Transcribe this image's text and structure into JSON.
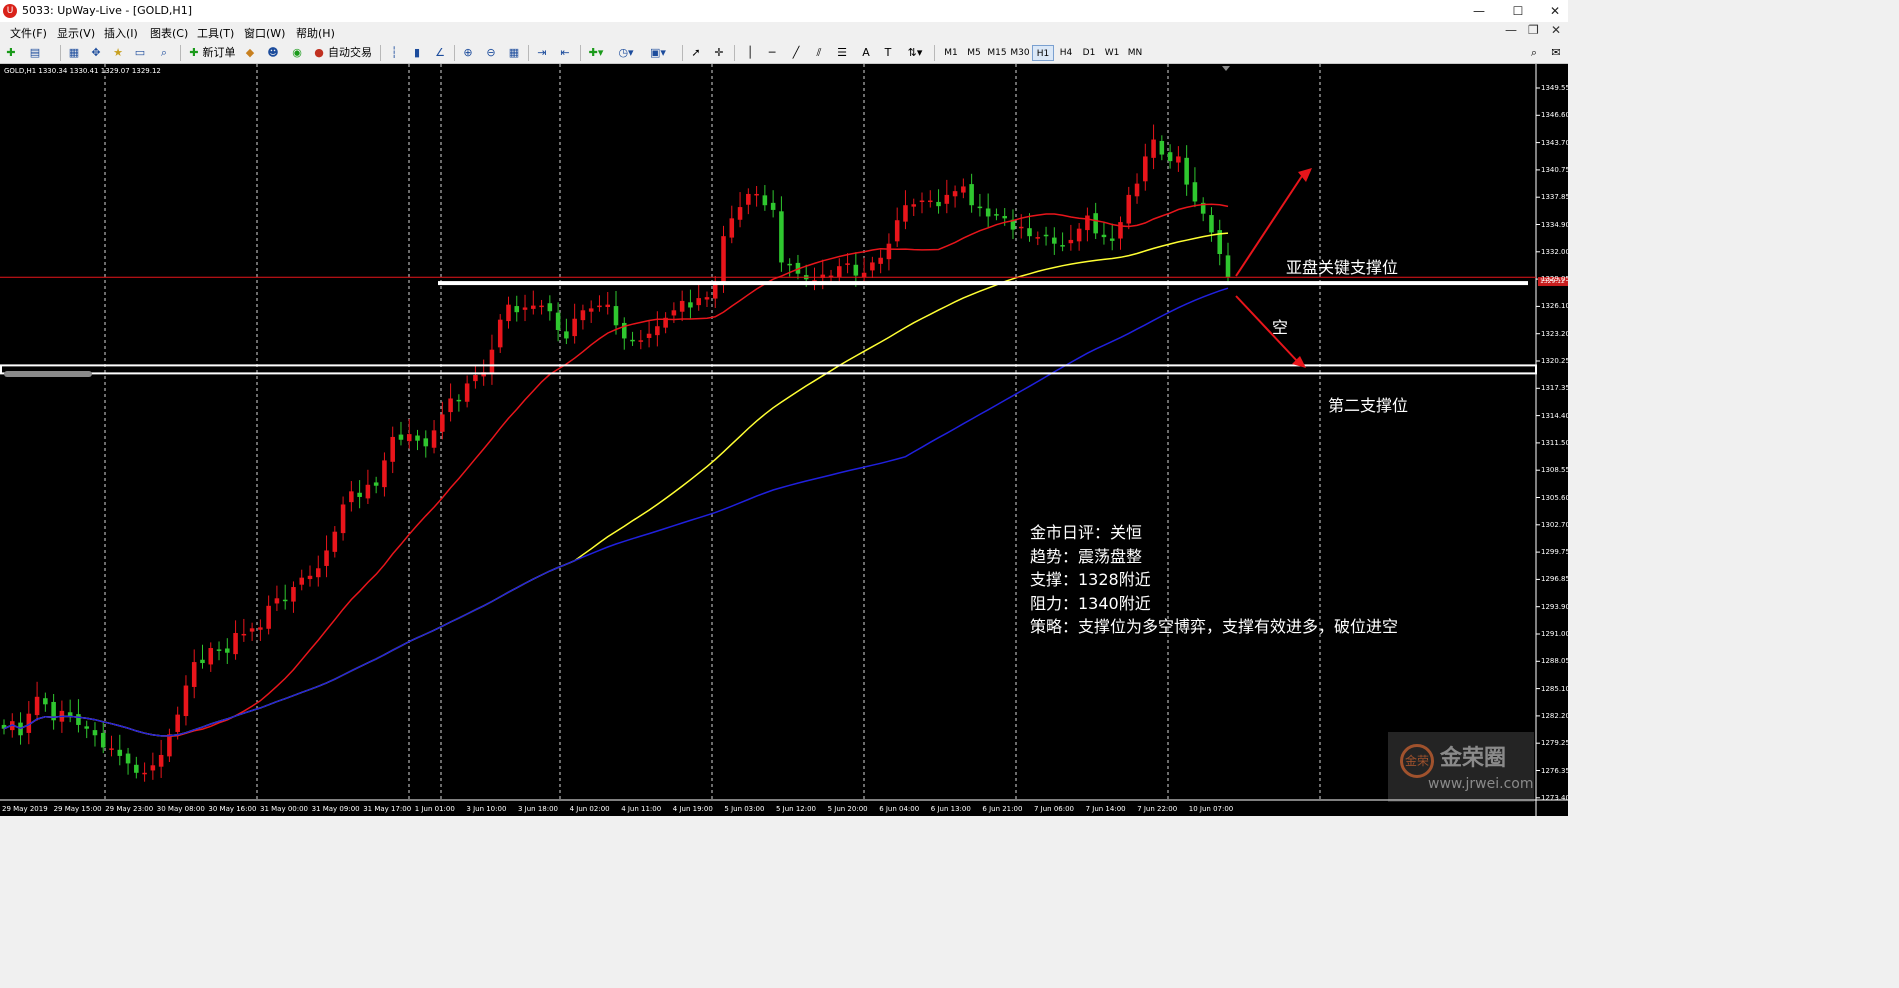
{
  "window": {
    "title": "5033: UpWay-Live - [GOLD,H1]",
    "app_icon": "upway-logo-icon",
    "minimize": "—",
    "maximize": "☐",
    "close": "✕"
  },
  "menu": {
    "items": [
      "文件(F)",
      "显示(V)",
      "插入(I)",
      "图表(C)",
      "工具(T)",
      "窗口(W)",
      "帮助(H)"
    ],
    "right_minimize": "—",
    "right_restore": "❐",
    "right_close": "✕"
  },
  "toolbar": {
    "new_order": "新订单",
    "auto_trade": "自动交易",
    "timeframes": [
      "M1",
      "M5",
      "M15",
      "M30",
      "H1",
      "H4",
      "D1",
      "W1",
      "MN"
    ],
    "active_timeframe": "H1",
    "text_tool": "A",
    "label_tool": "T"
  },
  "chart_header": "GOLD,H1  1330.34 1330.41 1329.07 1329.12",
  "price_axis": [
    "1349.55",
    "1346.60",
    "1343.70",
    "1340.75",
    "1337.85",
    "1334.90",
    "1332.00",
    "1329.05",
    "1326.10",
    "1323.20",
    "1320.25",
    "1317.35",
    "1314.40",
    "1311.50",
    "1308.55",
    "1305.60",
    "1302.70",
    "1299.75",
    "1296.85",
    "1293.90",
    "1291.00",
    "1288.05",
    "1285.10",
    "1282.20",
    "1279.25",
    "1276.35",
    "1273.40"
  ],
  "current_price_tag": "1329.12",
  "time_axis": [
    "29 May 2019",
    "29 May 15:00",
    "29 May 23:00",
    "30 May 08:00",
    "30 May 16:00",
    "31 May 00:00",
    "31 May 09:00",
    "31 May 17:00",
    "1 Jun 01:00",
    "3 Jun 10:00",
    "3 Jun 18:00",
    "4 Jun 02:00",
    "4 Jun 11:00",
    "4 Jun 19:00",
    "5 Jun 03:00",
    "5 Jun 12:00",
    "5 Jun 20:00",
    "6 Jun 04:00",
    "6 Jun 13:00",
    "6 Jun 21:00",
    "7 Jun 06:00",
    "7 Jun 14:00",
    "7 Jun 22:00",
    "10 Jun 07:00"
  ],
  "annotations": {
    "key_support": "亚盘关键支撑位",
    "short": "空",
    "second_support": "第二支撑位"
  },
  "commentary": {
    "title": "金市日评：关恒",
    "trend": "趋势：震荡盘整",
    "support": "支撑：1328附近",
    "resistance": "阻力：1340附近",
    "strategy": "策略：支撑位为多空博弈，支撑有效进多，破位进空"
  },
  "watermark": {
    "name": "金荣圈",
    "url": "www.jrwei.com",
    "logo": "金荣"
  },
  "colors": {
    "bull": "#e8151b",
    "bear": "#2fc72f",
    "ma_fast": "#e8151b",
    "ma_mid": "#ffff33",
    "ma_slow": "#2020dd",
    "support_line": "#ffffff",
    "arrow": "#e8151b",
    "background": "#000000",
    "grid": "#ffffff"
  },
  "chart_data": {
    "type": "candlestick",
    "symbol": "GOLD",
    "timeframe": "H1",
    "ylim": [
      1273.4,
      1351.0
    ],
    "support_levels": [
      1328.5,
      1319.3
    ],
    "ohlc_summary": {
      "open": 1330.34,
      "high": 1330.41,
      "low": 1329.07,
      "close": 1329.12
    },
    "close": [
      1281.0,
      1281.8,
      1280.3,
      1282.6,
      1284.4,
      1283.6,
      1281.9,
      1282.9,
      1282.3,
      1281.4,
      1281.0,
      1280.3,
      1279.0,
      1278.9,
      1278.1,
      1277.3,
      1276.3,
      1276.3,
      1277.1,
      1278.2,
      1280.4,
      1282.5,
      1285.6,
      1288.1,
      1288.0,
      1289.6,
      1289.3,
      1289.1,
      1291.2,
      1291.1,
      1291.7,
      1291.8,
      1294.1,
      1294.9,
      1294.7,
      1296.1,
      1297.1,
      1297.3,
      1298.1,
      1300.0,
      1302.0,
      1304.9,
      1306.3,
      1305.7,
      1307.0,
      1306.9,
      1309.6,
      1312.1,
      1311.8,
      1312.4,
      1311.7,
      1311.1,
      1312.8,
      1314.5,
      1316.2,
      1316.0,
      1317.8,
      1318.7,
      1319.0,
      1321.4,
      1324.6,
      1326.2,
      1325.4,
      1325.9,
      1326.1,
      1326.1,
      1325.5,
      1323.5,
      1322.6,
      1324.7,
      1325.6,
      1325.8,
      1326.1,
      1326.2,
      1324.0,
      1322.6,
      1322.4,
      1322.4,
      1323.1,
      1323.9,
      1324.8,
      1325.6,
      1326.6,
      1325.9,
      1326.9,
      1327.0,
      1328.4,
      1333.5,
      1335.4,
      1336.6,
      1338.0,
      1338.0,
      1336.8,
      1336.3,
      1330.7,
      1330.4,
      1329.5,
      1328.9,
      1328.8,
      1329.4,
      1329.3,
      1330.3,
      1330.6,
      1329.3,
      1329.6,
      1330.7,
      1331.2,
      1332.7,
      1335.2,
      1336.8,
      1336.9,
      1337.3,
      1337.3,
      1336.7,
      1337.9,
      1338.3,
      1338.8,
      1336.8,
      1336.6,
      1335.6,
      1335.8,
      1335.4,
      1334.2,
      1334.5,
      1333.5,
      1333.4,
      1333.5,
      1332.7,
      1332.5,
      1333.1,
      1334.3,
      1335.7,
      1333.8,
      1333.4,
      1333.0,
      1335.0,
      1337.9,
      1339.1,
      1342.0,
      1343.8,
      1342.2,
      1341.5,
      1342.0,
      1339.0,
      1337.2,
      1335.9,
      1333.9,
      1331.6,
      1329.1
    ]
  }
}
